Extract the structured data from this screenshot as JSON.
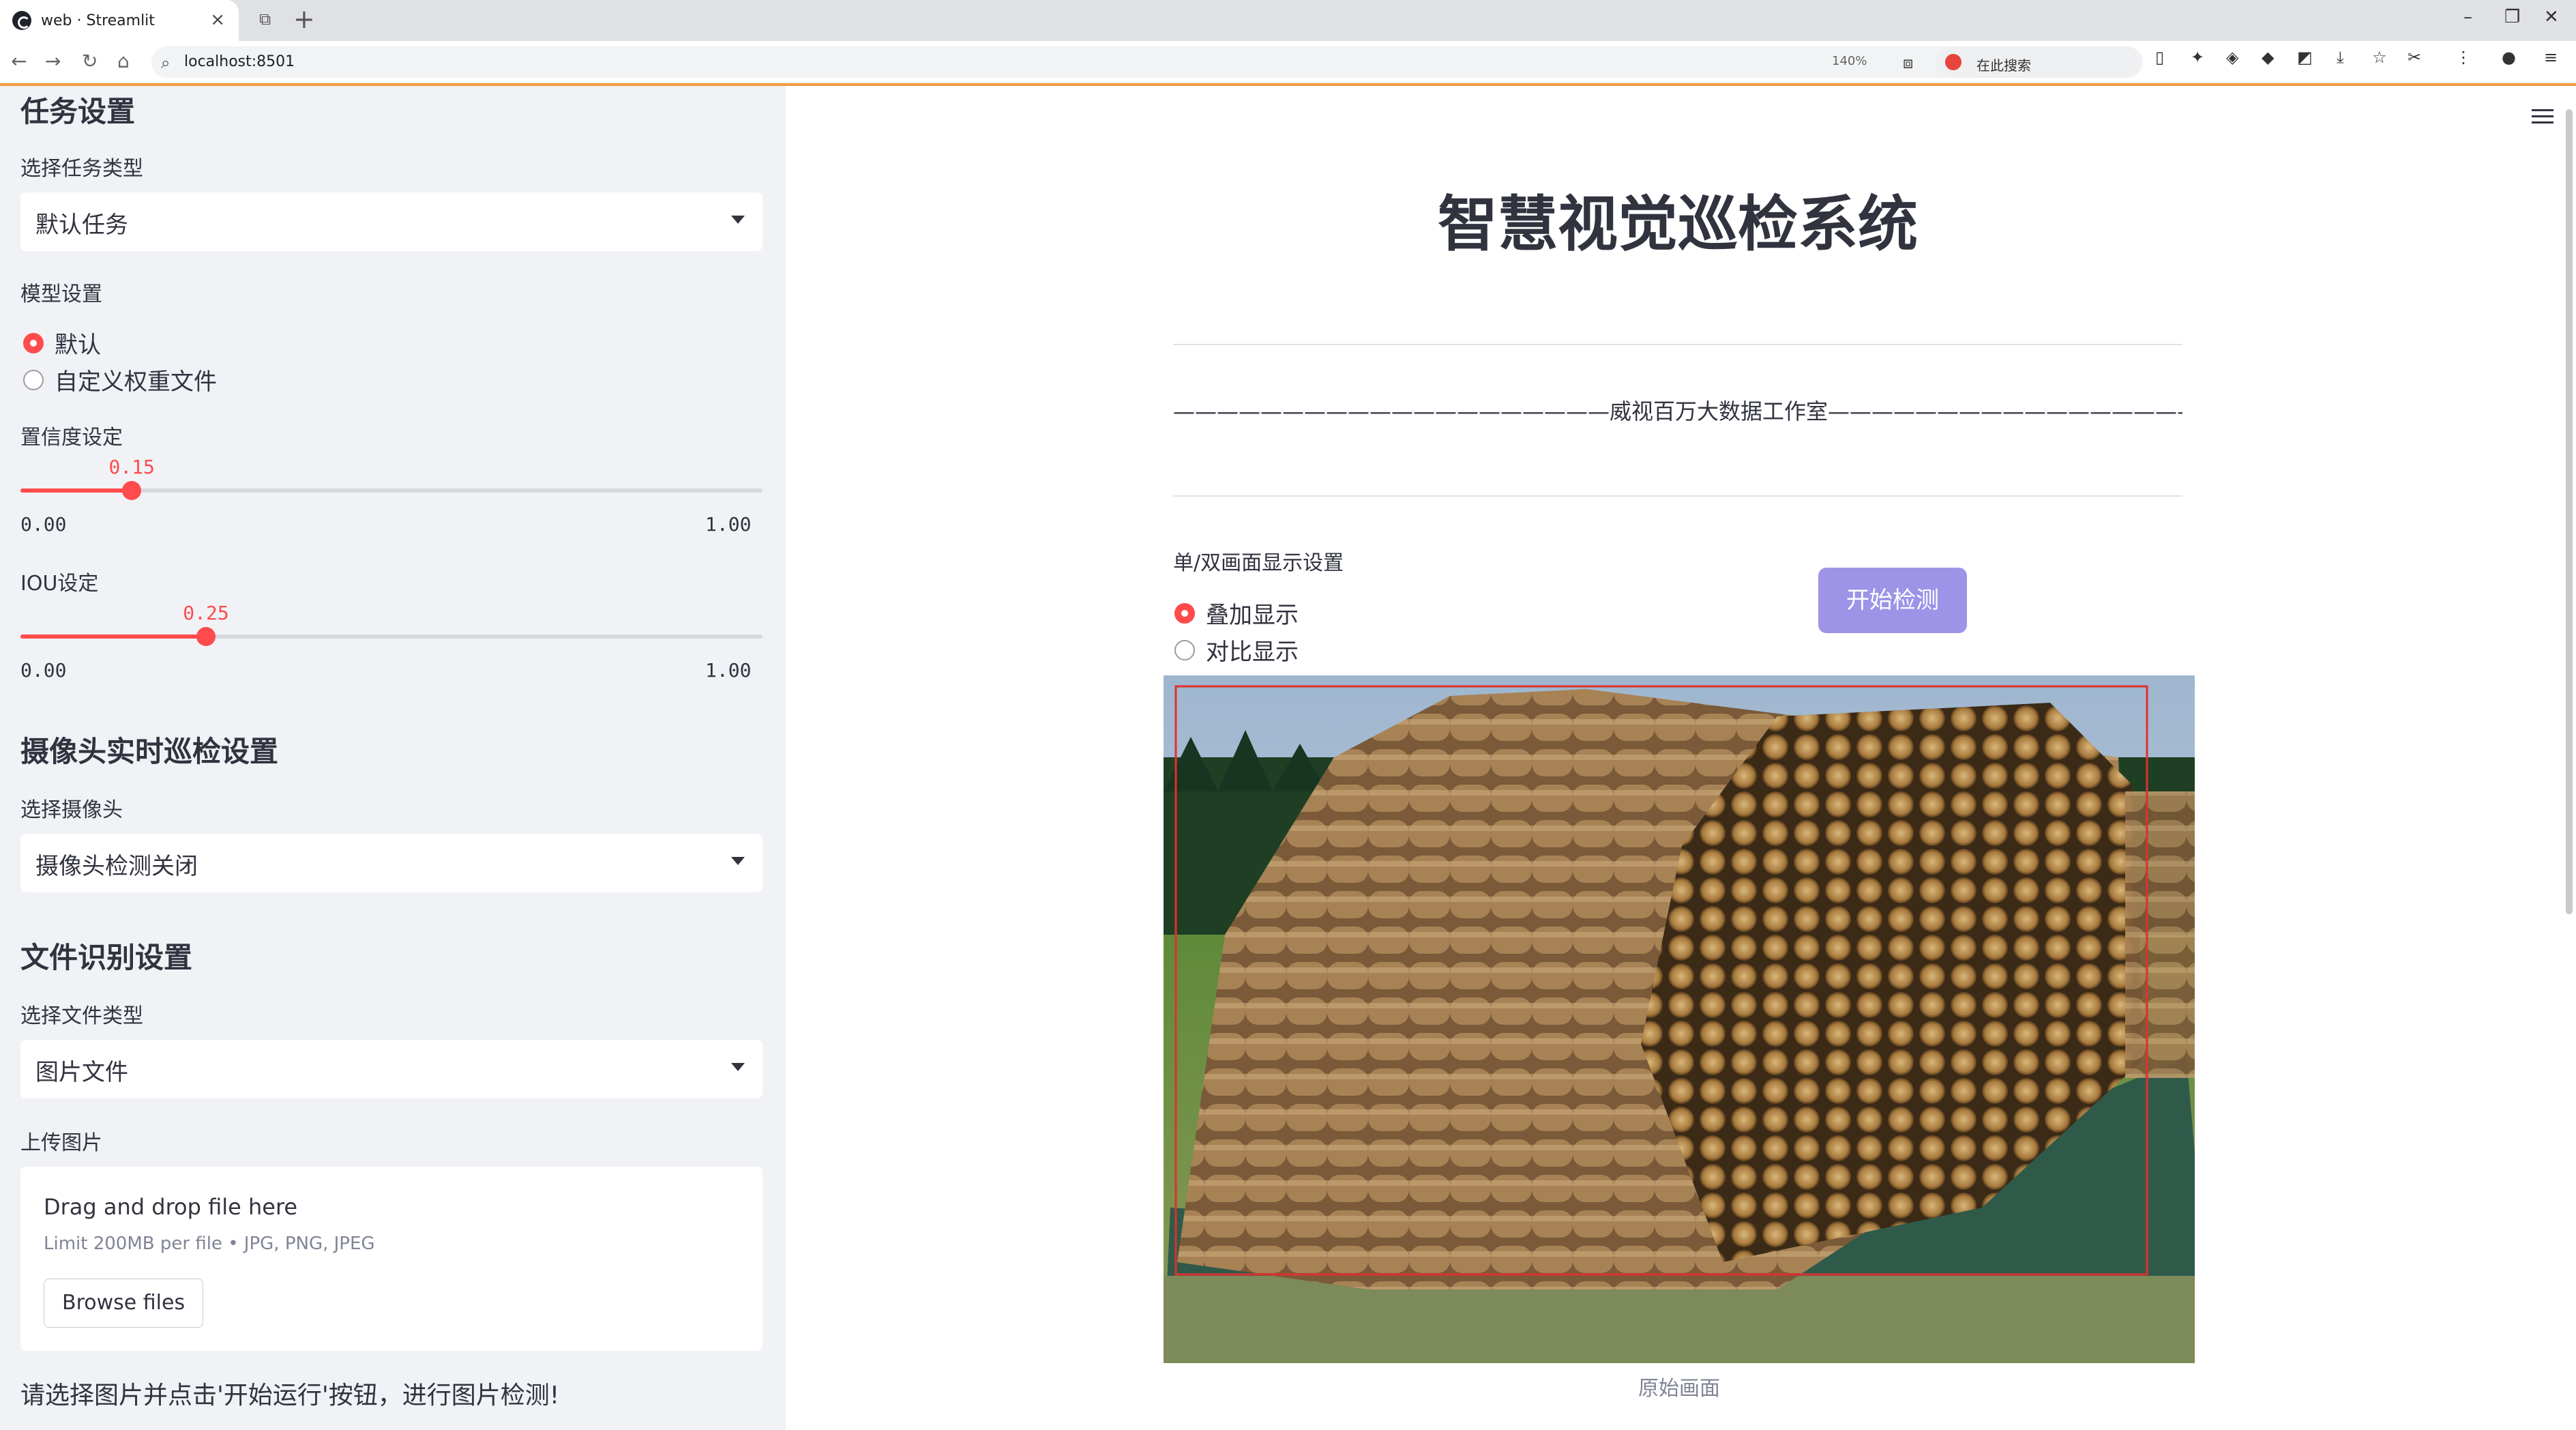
{
  "browser": {
    "tab_title": "web · Streamlit",
    "url": "localhost:8501",
    "zoom": "140%",
    "search_text": "在此搜索"
  },
  "sidebar": {
    "task_heading": "任务设置",
    "task_type_label": "选择任务类型",
    "task_type_value": "默认任务",
    "model_label": "模型设置",
    "model_options": [
      "默认",
      "自定义权重文件"
    ],
    "model_selected": "默认",
    "conf_label": "置信度设定",
    "conf_value": "0.15",
    "conf_level": 0.15,
    "conf_min": "0.00",
    "conf_max": "1.00",
    "iou_label": "IOU设定",
    "iou_value": "0.25",
    "iou_level": 0.25,
    "iou_min": "0.00",
    "iou_max": "1.00",
    "camera_heading": "摄像头实时巡检设置",
    "camera_label": "选择摄像头",
    "camera_value": "摄像头检测关闭",
    "file_heading": "文件识别设置",
    "file_type_label": "选择文件类型",
    "file_type_value": "图片文件",
    "upload_label": "上传图片",
    "upload_title": "Drag and drop file here",
    "upload_limit": "Limit 200MB per file • JPG, PNG, JPEG",
    "browse_label": "Browse files",
    "info_text": "请选择图片并点击'开始运行'按钮，进行图片检测!"
  },
  "main": {
    "title": "智慧视觉巡检系统",
    "subtitle": "————————————————————威视百万大数据工作室—————————————————————",
    "display_label": "单/双画面显示设置",
    "display_options": [
      "叠加显示",
      "对比显示"
    ],
    "display_selected": "叠加显示",
    "start_button": "开始检测",
    "image_caption": "原始画面"
  },
  "colors": {
    "accent": "#ff4b4b",
    "button": "#9d94e8",
    "sidebar_bg": "#f0f2f6",
    "detection_box": "#e0302f"
  }
}
